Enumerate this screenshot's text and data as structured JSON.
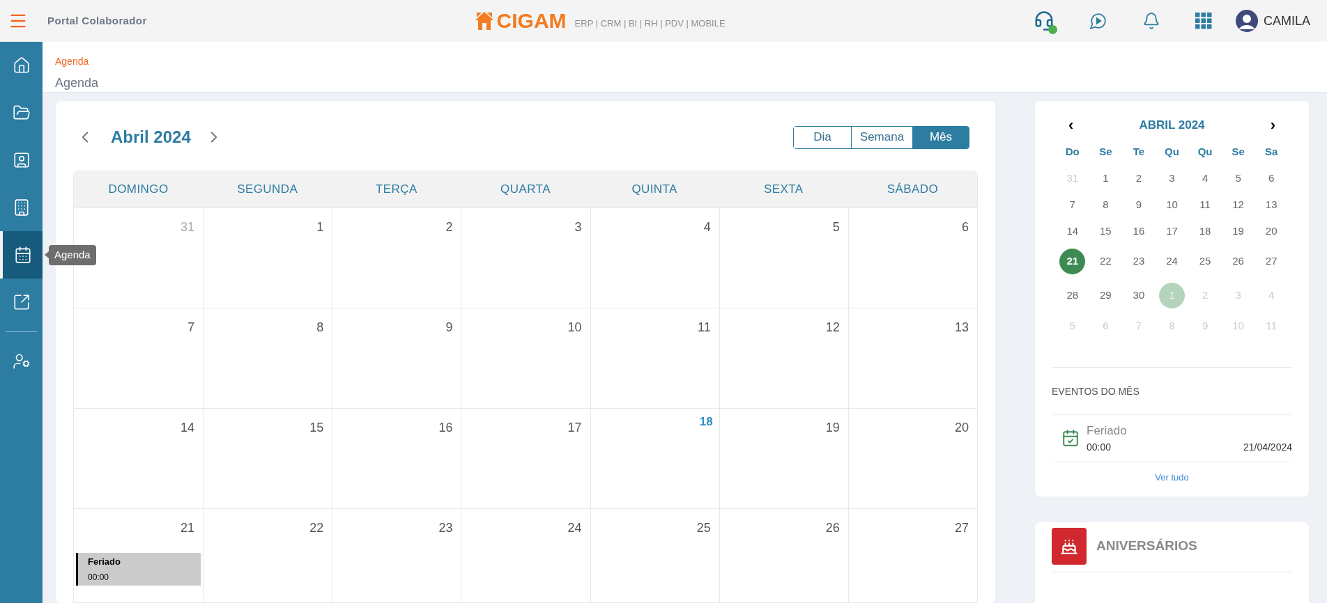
{
  "header": {
    "app_title": "Portal Colaborador",
    "logo_text": "CIGAM",
    "logo_tagline": "ERP | CRM | BI | RH | PDV | MOBILE",
    "support_online": true,
    "user_name": "CAMILA"
  },
  "sidebar": {
    "items": [
      {
        "kind": "home",
        "selected": false
      },
      {
        "kind": "folder",
        "selected": false
      },
      {
        "kind": "profile",
        "selected": false
      },
      {
        "kind": "company",
        "selected": false
      },
      {
        "kind": "calendar",
        "selected": true,
        "tooltip": "Agenda"
      },
      {
        "kind": "link",
        "selected": false
      },
      {
        "kind": "divider"
      },
      {
        "kind": "user-settings",
        "selected": false
      }
    ]
  },
  "breadcrumb": {
    "link": "Agenda",
    "page_title": "Agenda"
  },
  "calendar": {
    "title": "Abril 2024",
    "views": [
      {
        "label": "Dia",
        "selected": false
      },
      {
        "label": "Semana",
        "selected": false
      },
      {
        "label": "Mês",
        "selected": true
      }
    ],
    "weekdays": [
      "DOMINGO",
      "SEGUNDA",
      "TERÇA",
      "QUARTA",
      "QUINTA",
      "SEXTA",
      "SÁBADO"
    ],
    "weeks": [
      [
        {
          "day": "31",
          "muted": true,
          "today": false
        },
        {
          "day": "1",
          "muted": false,
          "today": false
        },
        {
          "day": "2",
          "muted": false,
          "today": false
        },
        {
          "day": "3",
          "muted": false,
          "today": false
        },
        {
          "day": "4",
          "muted": false,
          "today": false
        },
        {
          "day": "5",
          "muted": false,
          "today": false
        },
        {
          "day": "6",
          "muted": false,
          "today": false
        }
      ],
      [
        {
          "day": "7",
          "muted": false,
          "today": false
        },
        {
          "day": "8",
          "muted": false,
          "today": false
        },
        {
          "day": "9",
          "muted": false,
          "today": false
        },
        {
          "day": "10",
          "muted": false,
          "today": false
        },
        {
          "day": "11",
          "muted": false,
          "today": false
        },
        {
          "day": "12",
          "muted": false,
          "today": false
        },
        {
          "day": "13",
          "muted": false,
          "today": false
        }
      ],
      [
        {
          "day": "14",
          "muted": false,
          "today": false
        },
        {
          "day": "15",
          "muted": false,
          "today": false
        },
        {
          "day": "16",
          "muted": false,
          "today": false
        },
        {
          "day": "17",
          "muted": false,
          "today": false
        },
        {
          "day": "18",
          "muted": false,
          "today": true
        },
        {
          "day": "19",
          "muted": false,
          "today": false
        },
        {
          "day": "20",
          "muted": false,
          "today": false
        }
      ],
      [
        {
          "day": "21",
          "muted": false,
          "today": false,
          "events": [
            {
              "title": "Feriado",
              "time": "00:00"
            }
          ]
        },
        {
          "day": "22",
          "muted": false,
          "today": false
        },
        {
          "day": "23",
          "muted": false,
          "today": false
        },
        {
          "day": "24",
          "muted": false,
          "today": false
        },
        {
          "day": "25",
          "muted": false,
          "today": false
        },
        {
          "day": "26",
          "muted": false,
          "today": false
        },
        {
          "day": "27",
          "muted": false,
          "today": false
        }
      ]
    ]
  },
  "mini_calendar": {
    "prev": "‹",
    "title": "ABRIL 2024",
    "next": "›",
    "weekdays": [
      "Do",
      "Se",
      "Te",
      "Qu",
      "Qu",
      "Se",
      "Sa"
    ],
    "weeks": [
      [
        {
          "day": "31",
          "muted": true,
          "selected": false,
          "marked": false
        },
        {
          "day": "1",
          "muted": false,
          "selected": false,
          "marked": false
        },
        {
          "day": "2",
          "muted": false,
          "selected": false,
          "marked": false
        },
        {
          "day": "3",
          "muted": false,
          "selected": false,
          "marked": false
        },
        {
          "day": "4",
          "muted": false,
          "selected": false,
          "marked": false
        },
        {
          "day": "5",
          "muted": false,
          "selected": false,
          "marked": false
        },
        {
          "day": "6",
          "muted": false,
          "selected": false,
          "marked": false
        }
      ],
      [
        {
          "day": "7",
          "muted": false,
          "selected": false,
          "marked": false
        },
        {
          "day": "8",
          "muted": false,
          "selected": false,
          "marked": false
        },
        {
          "day": "9",
          "muted": false,
          "selected": false,
          "marked": false
        },
        {
          "day": "10",
          "muted": false,
          "selected": false,
          "marked": false
        },
        {
          "day": "11",
          "muted": false,
          "selected": false,
          "marked": false
        },
        {
          "day": "12",
          "muted": false,
          "selected": false,
          "marked": false
        },
        {
          "day": "13",
          "muted": false,
          "selected": false,
          "marked": false
        }
      ],
      [
        {
          "day": "14",
          "muted": false,
          "selected": false,
          "marked": false
        },
        {
          "day": "15",
          "muted": false,
          "selected": false,
          "marked": false
        },
        {
          "day": "16",
          "muted": false,
          "selected": false,
          "marked": false
        },
        {
          "day": "17",
          "muted": false,
          "selected": false,
          "marked": false
        },
        {
          "day": "18",
          "muted": false,
          "selected": false,
          "marked": false
        },
        {
          "day": "19",
          "muted": false,
          "selected": false,
          "marked": false
        },
        {
          "day": "20",
          "muted": false,
          "selected": false,
          "marked": false
        }
      ],
      [
        {
          "day": "21",
          "muted": false,
          "selected": true,
          "marked": false
        },
        {
          "day": "22",
          "muted": false,
          "selected": false,
          "marked": false
        },
        {
          "day": "23",
          "muted": false,
          "selected": false,
          "marked": false
        },
        {
          "day": "24",
          "muted": false,
          "selected": false,
          "marked": false
        },
        {
          "day": "25",
          "muted": false,
          "selected": false,
          "marked": false
        },
        {
          "day": "26",
          "muted": false,
          "selected": false,
          "marked": false
        },
        {
          "day": "27",
          "muted": false,
          "selected": false,
          "marked": false
        }
      ],
      [
        {
          "day": "28",
          "muted": false,
          "selected": false,
          "marked": false
        },
        {
          "day": "29",
          "muted": false,
          "selected": false,
          "marked": false
        },
        {
          "day": "30",
          "muted": false,
          "selected": false,
          "marked": false
        },
        {
          "day": "1",
          "muted": true,
          "selected": false,
          "marked": true
        },
        {
          "day": "2",
          "muted": true,
          "selected": false,
          "marked": false
        },
        {
          "day": "3",
          "muted": true,
          "selected": false,
          "marked": false
        },
        {
          "day": "4",
          "muted": true,
          "selected": false,
          "marked": false
        }
      ],
      [
        {
          "day": "5",
          "muted": true,
          "selected": false,
          "marked": false
        },
        {
          "day": "6",
          "muted": true,
          "selected": false,
          "marked": false
        },
        {
          "day": "7",
          "muted": true,
          "selected": false,
          "marked": false
        },
        {
          "day": "8",
          "muted": true,
          "selected": false,
          "marked": false
        },
        {
          "day": "9",
          "muted": true,
          "selected": false,
          "marked": false
        },
        {
          "day": "10",
          "muted": true,
          "selected": false,
          "marked": false
        },
        {
          "day": "11",
          "muted": true,
          "selected": false,
          "marked": false
        }
      ]
    ]
  },
  "month_events": {
    "heading": "EVENTOS DO MÊS",
    "items": [
      {
        "title": "Feriado",
        "time": "00:00",
        "date": "21/04/2024"
      }
    ],
    "see_all": "Ver tudo"
  },
  "birthdays": {
    "heading": "ANIVERSÁRIOS"
  }
}
